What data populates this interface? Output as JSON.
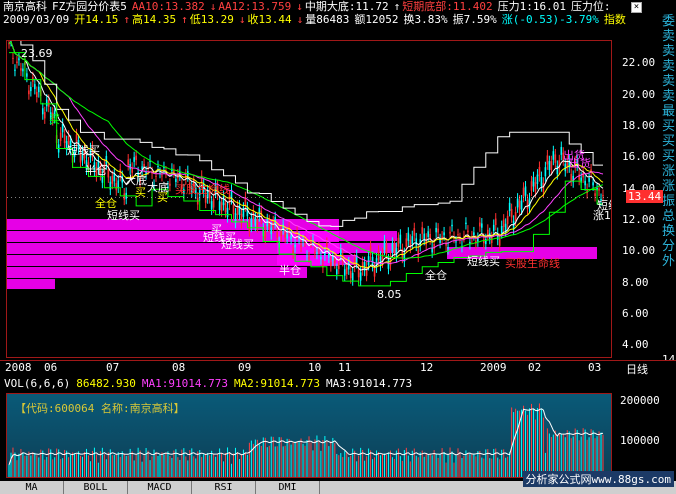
{
  "header": {
    "line1": [
      {
        "text": "南京高科",
        "color": "#ffffff"
      },
      {
        "text": "FZ方园分价表5",
        "color": "#ffffff"
      },
      {
        "text": "AA10:13.382",
        "color": "#ff4040"
      },
      {
        "text": "↓",
        "color": "#ff4040"
      },
      {
        "text": "AA12:13.759",
        "color": "#ff4040"
      },
      {
        "text": "↓",
        "color": "#ff4040"
      },
      {
        "text": "中期大底:11.72",
        "color": "#ffffff"
      },
      {
        "text": "↑",
        "color": "#ffffff"
      },
      {
        "text": "短期底部:11.402",
        "color": "#ff4040"
      },
      {
        "text": "压力1:16.01",
        "color": "#ffffff"
      },
      {
        "text": "压力位:",
        "color": "#ffffff"
      }
    ],
    "line2": [
      {
        "text": "2009/03/09",
        "color": "#ffffff"
      },
      {
        "text": "开14.15",
        "color": "#ffff00"
      },
      {
        "text": "↑",
        "color": "#ff4040"
      },
      {
        "text": "高14.35",
        "color": "#ffff00"
      },
      {
        "text": "↑",
        "color": "#ff4040"
      },
      {
        "text": "低13.29",
        "color": "#ffff00"
      },
      {
        "text": "↓",
        "color": "#ff4040"
      },
      {
        "text": "收13.44",
        "color": "#ffff00"
      },
      {
        "text": "↓",
        "color": "#ff4040"
      },
      {
        "text": "量86483",
        "color": "#ffffff"
      },
      {
        "text": "额12052",
        "color": "#ffffff"
      },
      {
        "text": "换3.83%",
        "color": "#ffffff"
      },
      {
        "text": "振7.59%",
        "color": "#ffffff"
      },
      {
        "text": "涨(-0.53)-3.79%",
        "color": "#00ffff"
      },
      {
        "text": "指数",
        "color": "#ffff00"
      }
    ]
  },
  "price_chart": {
    "y_ticks": [
      "22.00",
      "20.00",
      "18.00",
      "16.00",
      "14.00",
      "12.00",
      "10.00",
      "8.00",
      "6.00",
      "4.00"
    ],
    "high_label": "23.69",
    "low_label": "8.05",
    "current_price": "13.44",
    "annotations": [
      {
        "text": "买",
        "color": "#00ff00"
      },
      {
        "text": "短线买",
        "color": "#ffffff"
      },
      {
        "text": "半仓",
        "color": "#ffffff"
      },
      {
        "text": "全仓",
        "color": "#ffff00"
      },
      {
        "text": "短线买",
        "color": "#ffffff"
      },
      {
        "text": "大底",
        "color": "#ffffff"
      },
      {
        "text": "买",
        "color": "#ffff00"
      },
      {
        "text": "大底",
        "color": "#ffffff"
      },
      {
        "text": "买",
        "color": "#ffff00"
      },
      {
        "text": "买股生命线",
        "color": "#ff3030"
      },
      {
        "text": "买",
        "color": "#ffffff"
      },
      {
        "text": "短线买",
        "color": "#ffffff"
      },
      {
        "text": "短线买",
        "color": "#ffffff"
      },
      {
        "text": "半仓",
        "color": "#ffffff"
      },
      {
        "text": "全仓",
        "color": "#ffffff"
      },
      {
        "text": "短线买",
        "color": "#ffffff"
      },
      {
        "text": "买股生命线",
        "color": "#ff3030"
      },
      {
        "text": "出货",
        "color": "#ff40ff"
      },
      {
        "text": "出货",
        "color": "#ff40ff"
      },
      {
        "text": "涨10%",
        "color": "#ffffff"
      },
      {
        "text": "短线买",
        "color": "#ffffff"
      }
    ],
    "x_ticks": [
      "2008",
      "06",
      "07",
      "08",
      "09",
      "10",
      "11",
      "12",
      "2009",
      "02",
      "03"
    ],
    "period": "日线"
  },
  "sidebar": [
    "委",
    "卖",
    "卖",
    "卖",
    "卖",
    "卖",
    "最",
    "买",
    "买",
    "买",
    "涨",
    "涨",
    "振",
    "总",
    "换",
    "分",
    "外"
  ],
  "sidebar_value": "14",
  "volume": {
    "title": "VOL(6,6,6)",
    "value": "86482.930",
    "ma": [
      {
        "text": "MA1:91014.773",
        "color": "#ff40ff"
      },
      {
        "text": "MA2:91014.773",
        "color": "#ffff00"
      },
      {
        "text": "MA3:91014.773",
        "color": "#ffffff"
      }
    ],
    "info": "【代码:600064 名称:南京高科】",
    "y_ticks": [
      "200000",
      "100000"
    ]
  },
  "tabs": [
    "MA",
    "BOLL",
    "MACD",
    "RSI",
    "DMI"
  ],
  "watermark": "分析家公式网www.88gs.com"
}
